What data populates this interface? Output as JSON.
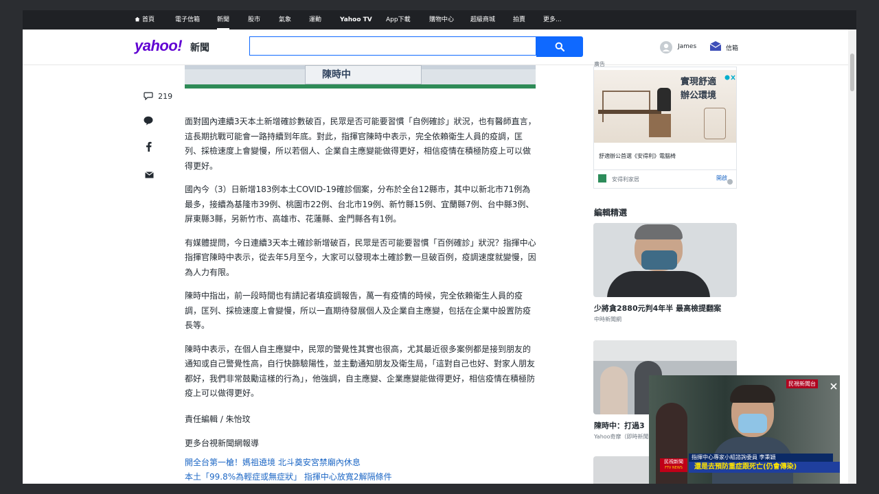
{
  "topnav": {
    "items": [
      {
        "label": "首頁"
      },
      {
        "label": "電子信箱"
      },
      {
        "label": "新聞"
      },
      {
        "label": "股市"
      },
      {
        "label": "氣象"
      },
      {
        "label": "運動"
      },
      {
        "label": "Yahoo TV"
      },
      {
        "label": "App下載"
      },
      {
        "label": "購物中心"
      },
      {
        "label": "超級商城"
      },
      {
        "label": "拍賣"
      },
      {
        "label": "更多..."
      }
    ],
    "active": "新聞"
  },
  "header": {
    "logo_text": "yahoo!",
    "logo_sub": "新聞",
    "search_value": "",
    "user_name": "James",
    "mail_label": "信箱"
  },
  "share": {
    "comment_count": "219"
  },
  "article": {
    "image_caption": "陳時中",
    "paragraphs": [
      "面對國內連續3天本土新增確診數破百，民眾是否可能要習慣「自例確診」狀況，也有醫師直言，這長期抗戰可能會一路持續到年底。對此，指揮官陳時中表示，完全依賴衛生人員的疫調，匡列、採檢速度上會變慢，所以若個人、企業自主應變能做得更好，相信疫情在積極防疫上可以做得更好。",
      "國內今（3）日新增183例本土COVID-19確診個案，分布於全台12縣市，其中以新北市71例為最多，接續為基隆市39例、桃園市22例、台北市19例、新竹縣15例、宜蘭縣7例、台中縣3例、屏東縣3縣，另新竹市、高雄市、花蓮縣、金門縣各有1例。",
      "有媒體提問，今日連續3天本土確診新增破百，民眾是否可能要習慣「百例確診」狀況？指揮中心指揮官陳時中表示，從去年5月至今，大家可以發現本土確診數一旦破百例，疫調速度就變慢，因為人力有限。",
      "陳時中指出，前一段時間也有請記者填疫調報告，萬一有疫情的時候，完全依賴衛生人員的疫調，匡列、採檢速度上會變慢，所以一直期待發展個人及企業自主應變，包括在企業中設置防疫長等。",
      "陳時中表示，在個人自主應變中，民眾的警覺性其實也很高，尤其最近很多案例都是接到朋友的通知或自己警覺性高，自行快篩驗陽性，並主動通知朋友及衛生局，「這對自己也好、對家人朋友都好，我們非常鼓勵這樣的行為」，他強調，自主應變、企業應變能做得更好，相信疫情在積極防疫上可以做得更好。"
    ],
    "editor": "責任編輯 / 朱怡玟",
    "more_title": "更多台視新聞網報導",
    "links": [
      "開全台第一槍！媽祖遶境 北斗奠安宮禁廟內休息",
      "本土「99.8%為輕症或無症狀」 指揮中心放寬2解隔條件"
    ]
  },
  "ad": {
    "label": "廣告",
    "headline_1": "實現舒適",
    "headline_2": "辦公環境",
    "desc": "舒適辦公首選《安得利》電腦椅",
    "advertiser": "安得利家居",
    "cta": "開啟"
  },
  "rail": {
    "section_title": "編輯精選",
    "cards": [
      {
        "title": "少將貪2880元判4年半 最高檢提翻案",
        "source": "中時新聞網"
      },
      {
        "title": "陳時中：打過3",
        "source": "Yahoo奇摩（即時新聞"
      }
    ]
  },
  "video": {
    "station": "民視新聞台",
    "name_bar": "指揮中心專家小組諮詢委員 李秉穎",
    "caption": "還是去預防重症跟死亡(仍會傳染)",
    "logo_small": "民視新聞",
    "logo_sub": "FTV NEWS"
  },
  "colors": {
    "nav_bg": "#1f2125",
    "brand": "#6001d2",
    "search_blue": "#0f69ff",
    "link": "#1d67c5"
  }
}
